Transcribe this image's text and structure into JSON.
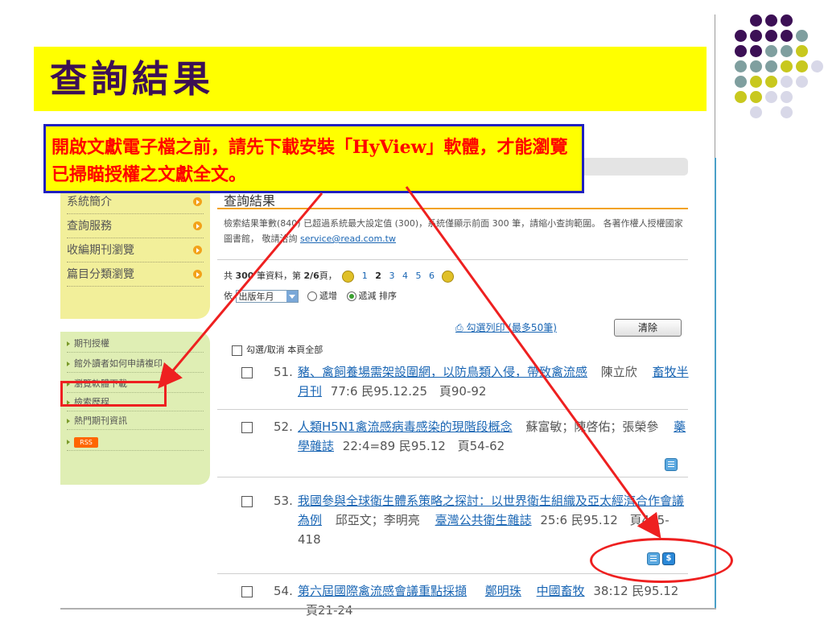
{
  "slide": {
    "title": "查詢結果",
    "callout": "開啟文獻電子檔之前，請先下載安裝「HyView」軟體，才能瀏覽已掃瞄授權之文獻全文。"
  },
  "sidebar": {
    "nav": [
      "系統簡介",
      "查詢服務",
      "收編期刊瀏覽",
      "篇目分類瀏覽"
    ],
    "links": [
      "期刊授權",
      "館外讀者如何申請複印",
      "瀏覽軟體下載",
      "檢索歷程",
      "熱門期刊資訊"
    ],
    "rss_label": "RSS"
  },
  "results": {
    "heading": "查詢結果",
    "note_text": "檢索結果筆數(840) 已超過系統最大設定值 (300)，系統僅顯示前面 300 筆，請縮小查詢範圍。 各著作權人授權國家圖書館， 敬請洽詢",
    "note_email": "service@read.com.tw",
    "pager_prefix": "共",
    "pager_total": "300",
    "pager_middle": "筆資料，第",
    "pager_current": "2/6",
    "pager_suffix": "頁，",
    "pages": [
      "1",
      "2",
      "3",
      "4",
      "5",
      "6"
    ],
    "sort_by": "依",
    "sort_select": "出版年月",
    "sort_asc": "遞增",
    "sort_desc": "遞減",
    "sort_suffix": "排序",
    "print_link": "勾選列印 (最多50筆)",
    "clear_button": "清除",
    "check_all": "勾選/取消 本頁全部",
    "records": [
      {
        "num": "51.",
        "title": "豬、禽飼養場需架設圍網，以防鳥類入侵，帶致禽流感",
        "authors": "陳立欣",
        "source": "畜牧半月刊",
        "meta": "77:6 民95.12.25",
        "pages": "頁90-92"
      },
      {
        "num": "52.",
        "title": "人類H5N1禽流感病毒感染的現階段概念",
        "authors": "蘇富敏；陳啓佑；張榮參",
        "source": "藥學雜誌",
        "meta": "22:4=89 民95.12",
        "pages": "頁54-62"
      },
      {
        "num": "53.",
        "title": "我國參與全球衛生體系策略之探討：以世界衛生組織及亞太經濟合作會議為例",
        "authors": "邱亞文；李明亮",
        "source": "臺灣公共衛生雜誌",
        "meta": "25:6 民95.12",
        "pages": "頁405-418"
      },
      {
        "num": "54.",
        "title": "第六屆國際禽流感會議重點採擷",
        "authors": "鄭明珠",
        "source": "中國畜牧",
        "meta": "38:12 民95.12",
        "pages": "頁21-24"
      }
    ],
    "cost_icon_glyph": "$"
  },
  "icons": {
    "page_prev": "prev-page-icon",
    "page_next": "next-page-icon",
    "fulltext": "document-icon",
    "cost": "dollar-icon",
    "dropdown": "chevron-down-icon"
  },
  "colors": {
    "title_band": "#ffff00",
    "title_text": "#3c1055",
    "callout_text": "#ff0000",
    "callout_border": "#2020c0",
    "annotation": "#ee2020",
    "link": "#1a66b4",
    "sidebar_top": "#f2ef9a",
    "sidebar_bottom": "#dfeeb4",
    "accent_orange": "#f2a21a",
    "dots": [
      "#3c1055",
      "#7f9f9f",
      "#c8c81e",
      "#d8d8e8"
    ]
  }
}
